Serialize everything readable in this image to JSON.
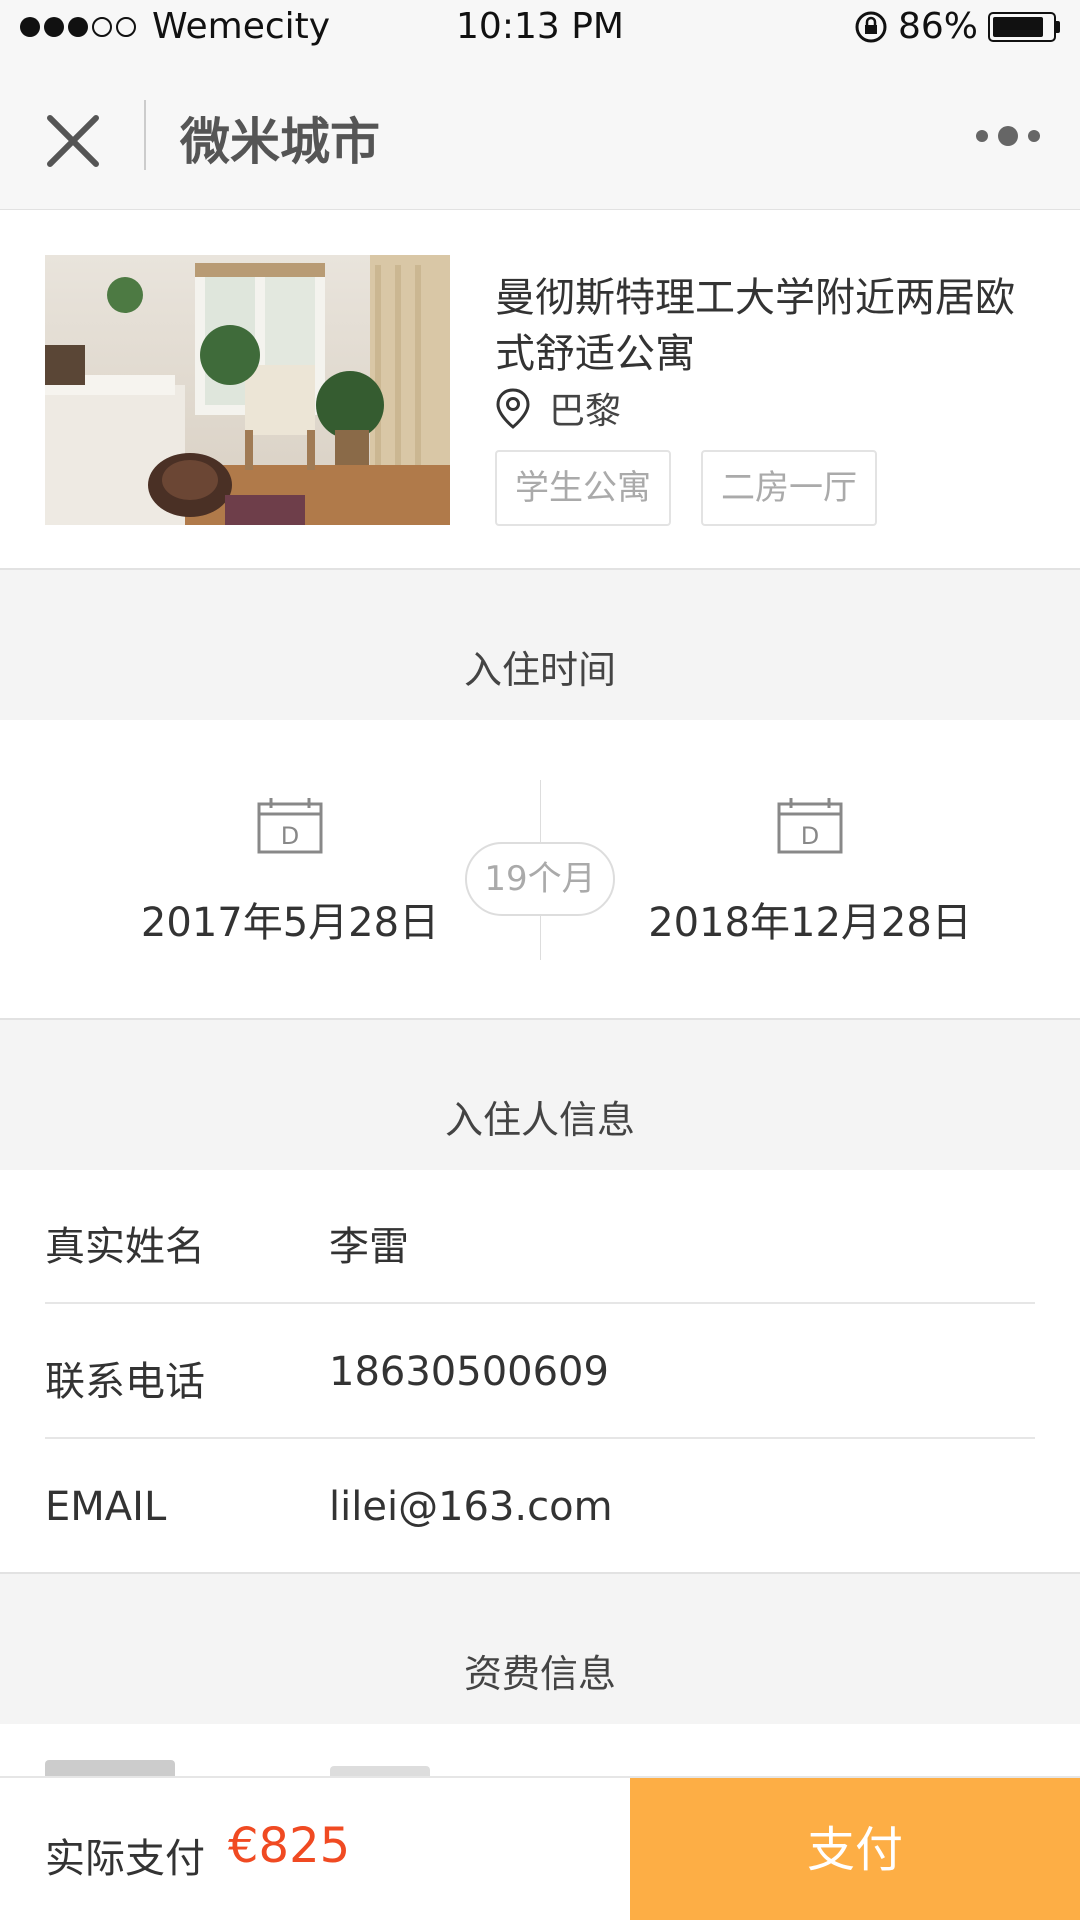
{
  "status_bar": {
    "carrier": "Wemecity",
    "signal_bars": 3,
    "signal_total": 5,
    "time": "10:13 PM",
    "battery_percent": "86%",
    "battery_level": 0.86
  },
  "nav": {
    "close_icon": "close-icon",
    "title": "微米城市",
    "more_icon": "more-icon"
  },
  "listing": {
    "title": "曼彻斯特理工大学附近两居欧式舒适公寓",
    "location": "巴黎",
    "tags": [
      "学生公寓",
      "二房一厅"
    ]
  },
  "checkin": {
    "header": "入住时间",
    "start_date": "2017年5月28日",
    "end_date": "2018年12月28日",
    "duration": "19个月",
    "calendar_glyph": "D"
  },
  "guest": {
    "header": "入住人信息",
    "rows": [
      {
        "label": "真实姓名",
        "value": "李雷"
      },
      {
        "label": "联系电话",
        "value": "18630500609"
      },
      {
        "label": "EMAIL",
        "value": "lilei@163.com"
      }
    ]
  },
  "fees": {
    "header": "资费信息"
  },
  "footer": {
    "pay_label": "实际支付",
    "amount": "€825",
    "pay_button": "支付"
  },
  "colors": {
    "accent": "#fdae45",
    "amount": "#f04a22",
    "background": "#f4f4f4"
  }
}
